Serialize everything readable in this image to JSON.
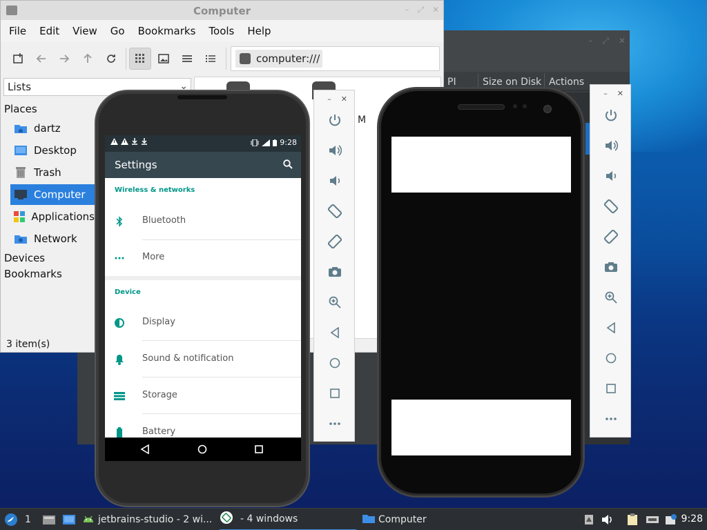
{
  "file_manager": {
    "title": "Computer",
    "menus": [
      "File",
      "Edit",
      "View",
      "Go",
      "Bookmarks",
      "Tools",
      "Help"
    ],
    "location": "computer:///",
    "view_selector": "Lists",
    "sidebar": {
      "places_heading": "Places",
      "items": [
        {
          "label": "dartz",
          "icon": "home-folder-icon"
        },
        {
          "label": "Desktop",
          "icon": "desktop-folder-icon"
        },
        {
          "label": "Trash",
          "icon": "trash-icon"
        },
        {
          "label": "Computer",
          "icon": "computer-icon",
          "selected": true
        },
        {
          "label": "Applications",
          "icon": "applications-icon"
        },
        {
          "label": "Network",
          "icon": "network-icon"
        }
      ],
      "devices_heading": "Devices",
      "bookmarks_heading": "Bookmarks"
    },
    "content_partial_label": "M",
    "status": "3 item(s)"
  },
  "background_window": {
    "columns": [
      "PI",
      "Size on Disk",
      "Actions"
    ]
  },
  "phone1": {
    "time": "9:28",
    "app_title": "Settings",
    "section_wireless": "Wireless & networks",
    "section_device": "Device",
    "rows": [
      {
        "label": "Bluetooth",
        "icon": "bluetooth-icon"
      },
      {
        "label": "More",
        "icon": "more-dots-icon"
      },
      {
        "label": "Display",
        "icon": "brightness-icon"
      },
      {
        "label": "Sound & notification",
        "icon": "bell-icon"
      },
      {
        "label": "Storage",
        "icon": "storage-icon"
      },
      {
        "label": "Battery",
        "icon": "battery-icon"
      }
    ]
  },
  "emulator_toolbar": {
    "buttons": [
      "power-icon",
      "volume-up-icon",
      "volume-down-icon",
      "rotate-left-icon",
      "rotate-right-icon",
      "camera-icon",
      "zoom-icon",
      "back-icon",
      "home-icon",
      "overview-icon",
      "more-icon"
    ]
  },
  "taskbar": {
    "workspace": "1",
    "tasks": [
      {
        "label": "jetbrains-studio - 2 wi...",
        "icon": "android-icon"
      },
      {
        "label": "- 4 windows",
        "icon": "emulator-icon",
        "active": true
      },
      {
        "label": "Computer",
        "icon": "folder-icon"
      }
    ],
    "clock": "9:28"
  },
  "colors": {
    "selection": "#2b80de",
    "teal_section": "#009688",
    "android_appbar": "#37474f"
  }
}
